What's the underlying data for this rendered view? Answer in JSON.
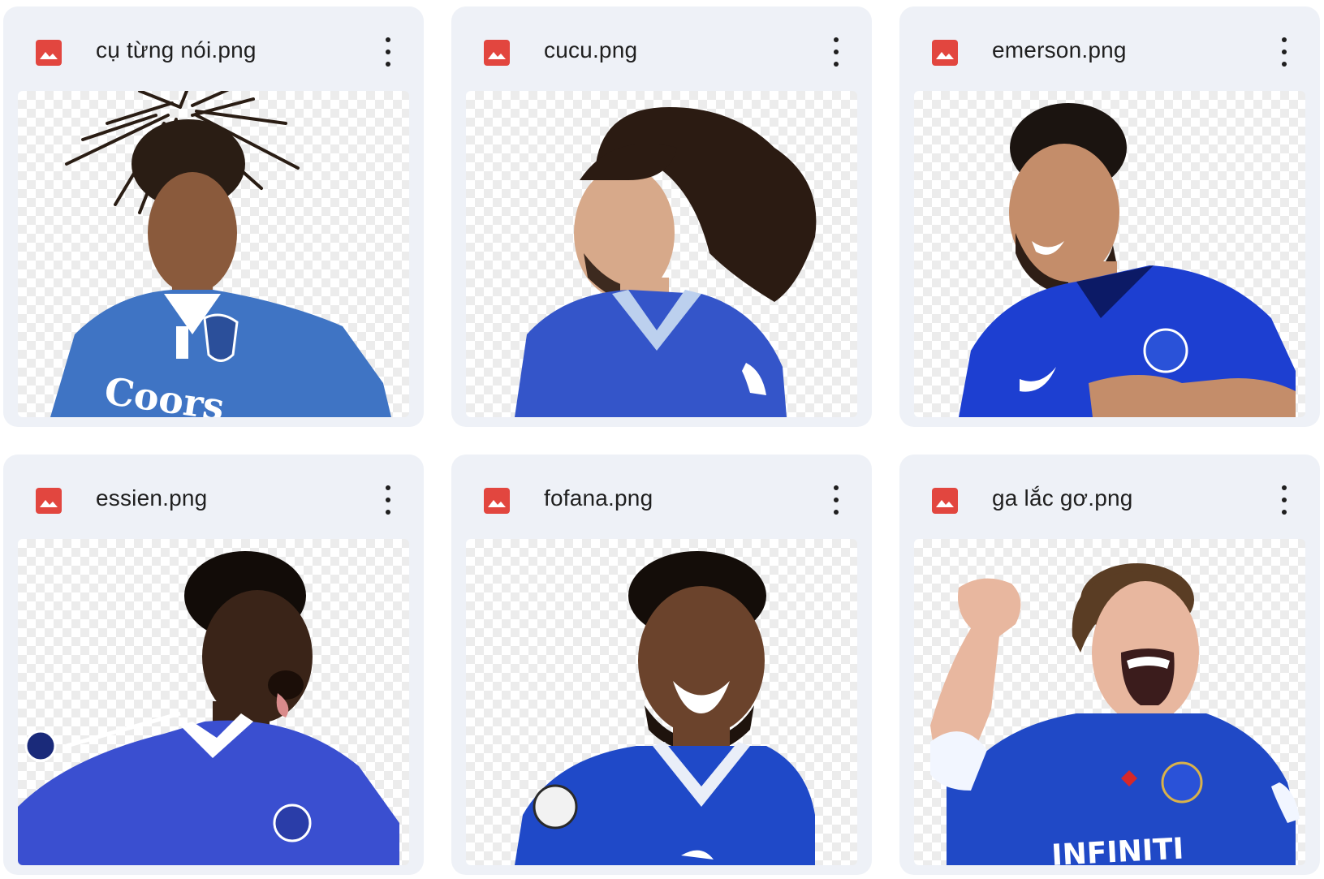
{
  "files": [
    {
      "name": "cụ từng nói.png",
      "icon": "image-file-icon",
      "menu_icon": "more-vert-icon",
      "jersey_color": "#3f74c4",
      "skin": "#8a5a3c",
      "hair": "#2a1d14"
    },
    {
      "name": "cucu.png",
      "icon": "image-file-icon",
      "menu_icon": "more-vert-icon",
      "jersey_color": "#3455c9",
      "skin": "#d7a98a",
      "hair": "#2b1b12"
    },
    {
      "name": "emerson.png",
      "icon": "image-file-icon",
      "menu_icon": "more-vert-icon",
      "jersey_color": "#1d3fd1",
      "skin": "#c48d6a",
      "hair": "#1b1410"
    },
    {
      "name": "essien.png",
      "icon": "image-file-icon",
      "menu_icon": "more-vert-icon",
      "jersey_color": "#3a4fd0",
      "skin": "#3a2418",
      "hair": "#120c08"
    },
    {
      "name": "fofana.png",
      "icon": "image-file-icon",
      "menu_icon": "more-vert-icon",
      "jersey_color": "#1f49c8",
      "skin": "#6b432c",
      "hair": "#140d09"
    },
    {
      "name": "ga lắc gơ.png",
      "icon": "image-file-icon",
      "menu_icon": "more-vert-icon",
      "jersey_color": "#2049c6",
      "skin": "#e8b79f",
      "hair": "#5a3d24"
    }
  ],
  "colors": {
    "card_background": "#eef1f7",
    "image_icon": "#e2463f",
    "text": "#1f1f1f"
  }
}
